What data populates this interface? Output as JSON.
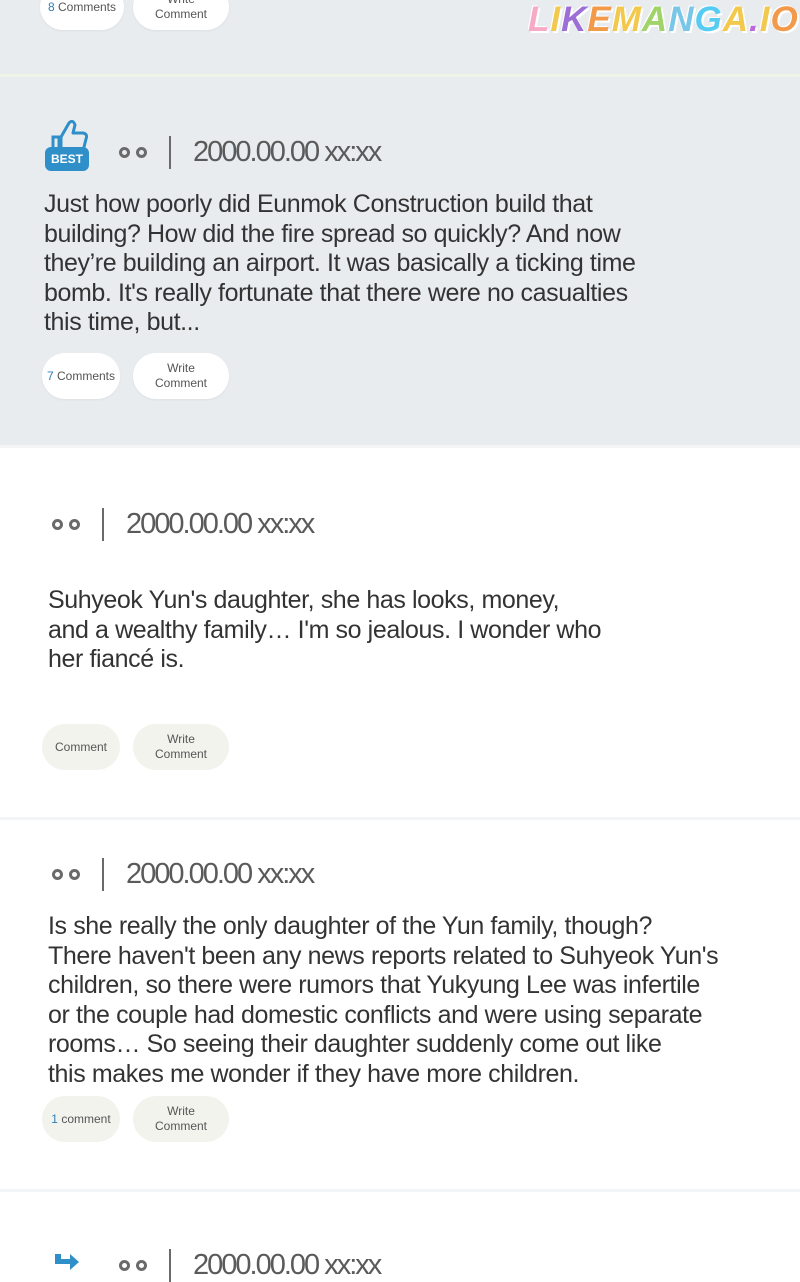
{
  "watermark": {
    "letters": [
      "L",
      "I",
      "K",
      "E",
      "M",
      "A",
      "N",
      "G",
      "A",
      ".",
      "I",
      "O"
    ],
    "colors": [
      "#f7a9c5",
      "#f2c94c",
      "#9b6fd6",
      "#f2994a",
      "#f2c94c",
      "#a0d468",
      "#7ac6e8",
      "#56ccf2",
      "#f2c94c",
      "#bb6bd9",
      "#f2c94c",
      "#f2994a"
    ]
  },
  "top_partial": {
    "comments_label": "8 Comments",
    "comments_count": "8",
    "comments_word": "Comments",
    "write_label": "Write Comment"
  },
  "best_post": {
    "badge": "BEST",
    "date": "2000.00.00 xx:xx",
    "text": "Just how poorly did Eunmok Construction build that\nbuilding? How did the fire spread so quickly? And now\nthey’re building an airport. It was basically a ticking time\nbomb. It's really fortunate that there were no casualties\nthis time, but...",
    "comments_count": "7",
    "comments_word": "Comments",
    "write_label": "Write Comment"
  },
  "post_2": {
    "date": "2000.00.00 xx:xx",
    "text": "Suhyeok Yun's daughter, she has looks, money,\nand a wealthy family… I'm so jealous. I wonder who\nher fiancé is.",
    "comments_label": "Comment",
    "write_label": "Write Comment"
  },
  "post_3": {
    "date": "2000.00.00 xx:xx",
    "text": "Is she really the only daughter of the Yun family, though?\nThere haven't been any news reports related to Suhyeok Yun's\nchildren, so there were rumors that Yukyung Lee was infertile\nor the couple had domestic conflicts and were using separate\nrooms… So seeing their daughter suddenly come out like\nthis makes me wonder if they have more children.",
    "comments_count": "1",
    "comments_word": "comment",
    "write_label": "Write Comment"
  },
  "reply_post": {
    "date": "2000.00.00 xx:xx"
  },
  "colors": {
    "gray_bg": "#e8ecef",
    "accent_blue": "#2f7fb5",
    "badge_blue": "#2f8fc9"
  },
  "icons": {
    "best_badge": "thumbs-up-icon",
    "reply": "reply-arrow-icon"
  }
}
